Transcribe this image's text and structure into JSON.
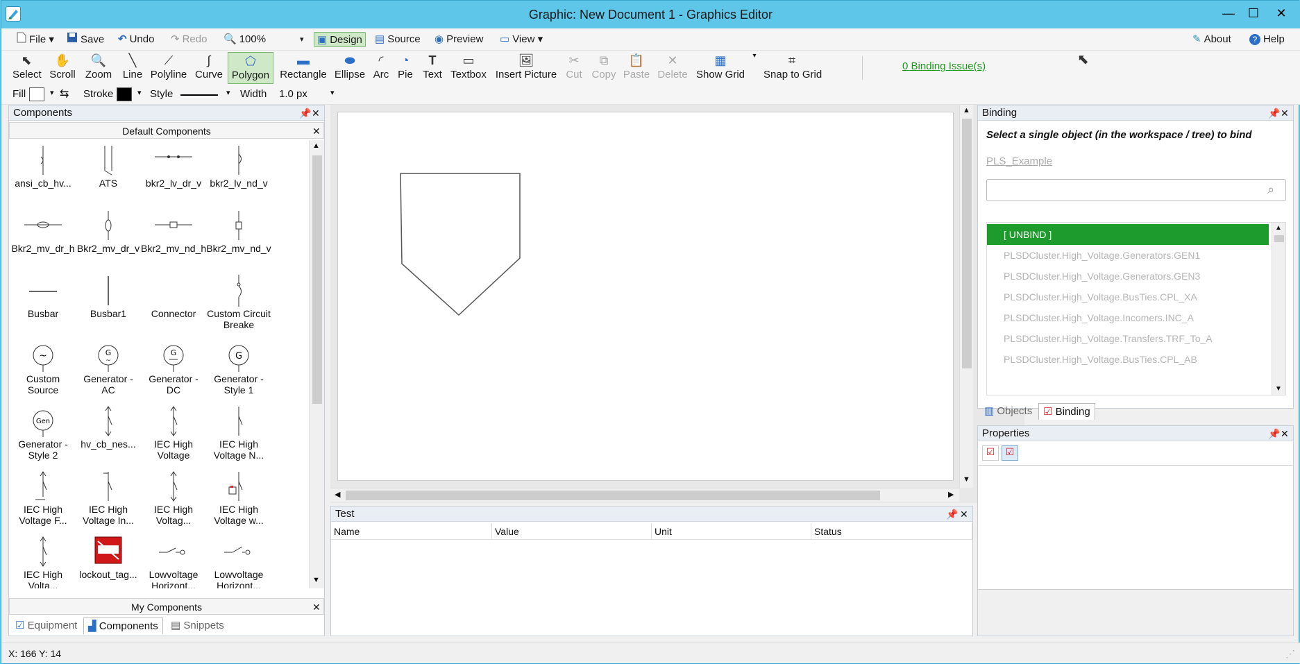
{
  "window": {
    "title": "Graphic: New Document 1 - Graphics Editor",
    "controls": [
      "—",
      "☐",
      "✕"
    ]
  },
  "menubar": {
    "file": "File",
    "save": "Save",
    "undo": "Undo",
    "redo": "Redo",
    "zoom_value": "100%",
    "design": "Design",
    "source": "Source",
    "preview": "Preview",
    "view": "View",
    "about": "About",
    "help": "Help"
  },
  "toolbar": {
    "tools": [
      {
        "label": "Select",
        "icon": "arrow-cursor-icon",
        "glyph": "⬉"
      },
      {
        "label": "Scroll",
        "icon": "hand-icon",
        "glyph": "✋"
      },
      {
        "label": "Zoom",
        "icon": "magnifier-icon",
        "glyph": "🔍"
      },
      {
        "label": "Line",
        "icon": "line-icon",
        "glyph": "╲"
      },
      {
        "label": "Polyline",
        "icon": "polyline-icon",
        "glyph": "⟋"
      },
      {
        "label": "Curve",
        "icon": "curve-icon",
        "glyph": "∫"
      },
      {
        "label": "Polygon",
        "icon": "polygon-icon",
        "glyph": "⬠"
      },
      {
        "label": "Rectangle",
        "icon": "rectangle-icon",
        "glyph": "▬"
      },
      {
        "label": "Ellipse",
        "icon": "ellipse-icon",
        "glyph": "⬬"
      },
      {
        "label": "Arc",
        "icon": "arc-icon",
        "glyph": "◜"
      },
      {
        "label": "Pie",
        "icon": "pie-icon",
        "glyph": "◔"
      },
      {
        "label": "Text",
        "icon": "text-icon",
        "glyph": "T"
      },
      {
        "label": "Textbox",
        "icon": "textbox-icon",
        "glyph": "▭"
      },
      {
        "label": "Insert Picture",
        "icon": "picture-icon",
        "glyph": "🖼"
      },
      {
        "label": "Cut",
        "icon": "scissors-icon",
        "glyph": "✂"
      },
      {
        "label": "Copy",
        "icon": "copy-icon",
        "glyph": "⧉"
      },
      {
        "label": "Paste",
        "icon": "paste-icon",
        "glyph": "📋"
      },
      {
        "label": "Delete",
        "icon": "delete-icon",
        "glyph": "✕"
      },
      {
        "label": "Show Grid",
        "icon": "grid-icon",
        "glyph": "▦"
      },
      {
        "label": "Snap to Grid",
        "icon": "snap-grid-icon",
        "glyph": "⌗"
      }
    ],
    "binding_issues": "0 Binding Issue(s)"
  },
  "stylebar": {
    "fill": "Fill",
    "stroke": "Stroke",
    "style": "Style",
    "width": "Width",
    "width_value": "1.0 px"
  },
  "components_panel": {
    "title": "Components",
    "default_header": "Default Components",
    "items": [
      "ansi_cb_hv...",
      "ATS",
      "bkr2_lv_dr_v",
      "bkr2_lv_nd_v",
      "Bkr2_mv_dr_h",
      "Bkr2_mv_dr_v",
      "Bkr2_mv_nd_h",
      "Bkr2_mv_nd_v",
      "Busbar",
      "Busbar1",
      "Connector",
      "Custom Circuit Breake",
      "Custom Source",
      "Generator - AC",
      "Generator - DC",
      "Generator - Style 1",
      "Generator - Style 2",
      "hv_cb_nes...",
      "IEC High Voltage",
      "IEC High Voltage  N...",
      "IEC High Voltage F...",
      "IEC High Voltage In...",
      "IEC High Voltag...",
      "IEC High Voltage w...",
      "IEC High Volta...",
      "lockout_tag...",
      "Lowvoltage Horizont...",
      "Lowvoltage Horizont..."
    ],
    "my_components": "My Components",
    "tabs": [
      "Equipment",
      "Components",
      "Snippets"
    ]
  },
  "test_panel": {
    "title": "Test",
    "columns": [
      "Name",
      "Value",
      "Unit",
      "Status"
    ]
  },
  "binding_panel": {
    "title": "Binding",
    "instruction": "Select a single object (in the workspace / tree) to bind",
    "link": "PLS_Example",
    "search_placeholder": "",
    "rows": [
      "[ UNBIND ]",
      "PLSDCluster.High_Voltage.Generators.GEN1",
      "PLSDCluster.High_Voltage.Generators.GEN3",
      "PLSDCluster.High_Voltage.BusTies.CPL_XA",
      "PLSDCluster.High_Voltage.Incomers.INC_A",
      "PLSDCluster.High_Voltage.Transfers.TRF_To_A",
      "PLSDCluster.High_Voltage.BusTies.CPL_AB"
    ],
    "tabs": [
      "Objects",
      "Binding"
    ]
  },
  "properties_panel": {
    "title": "Properties"
  },
  "status": {
    "coords": "X: 166  Y: 14"
  },
  "colors": {
    "titlebar": "#5ec6e8",
    "selected_row": "#1e9b2d",
    "link_green": "#1f9a1f"
  }
}
